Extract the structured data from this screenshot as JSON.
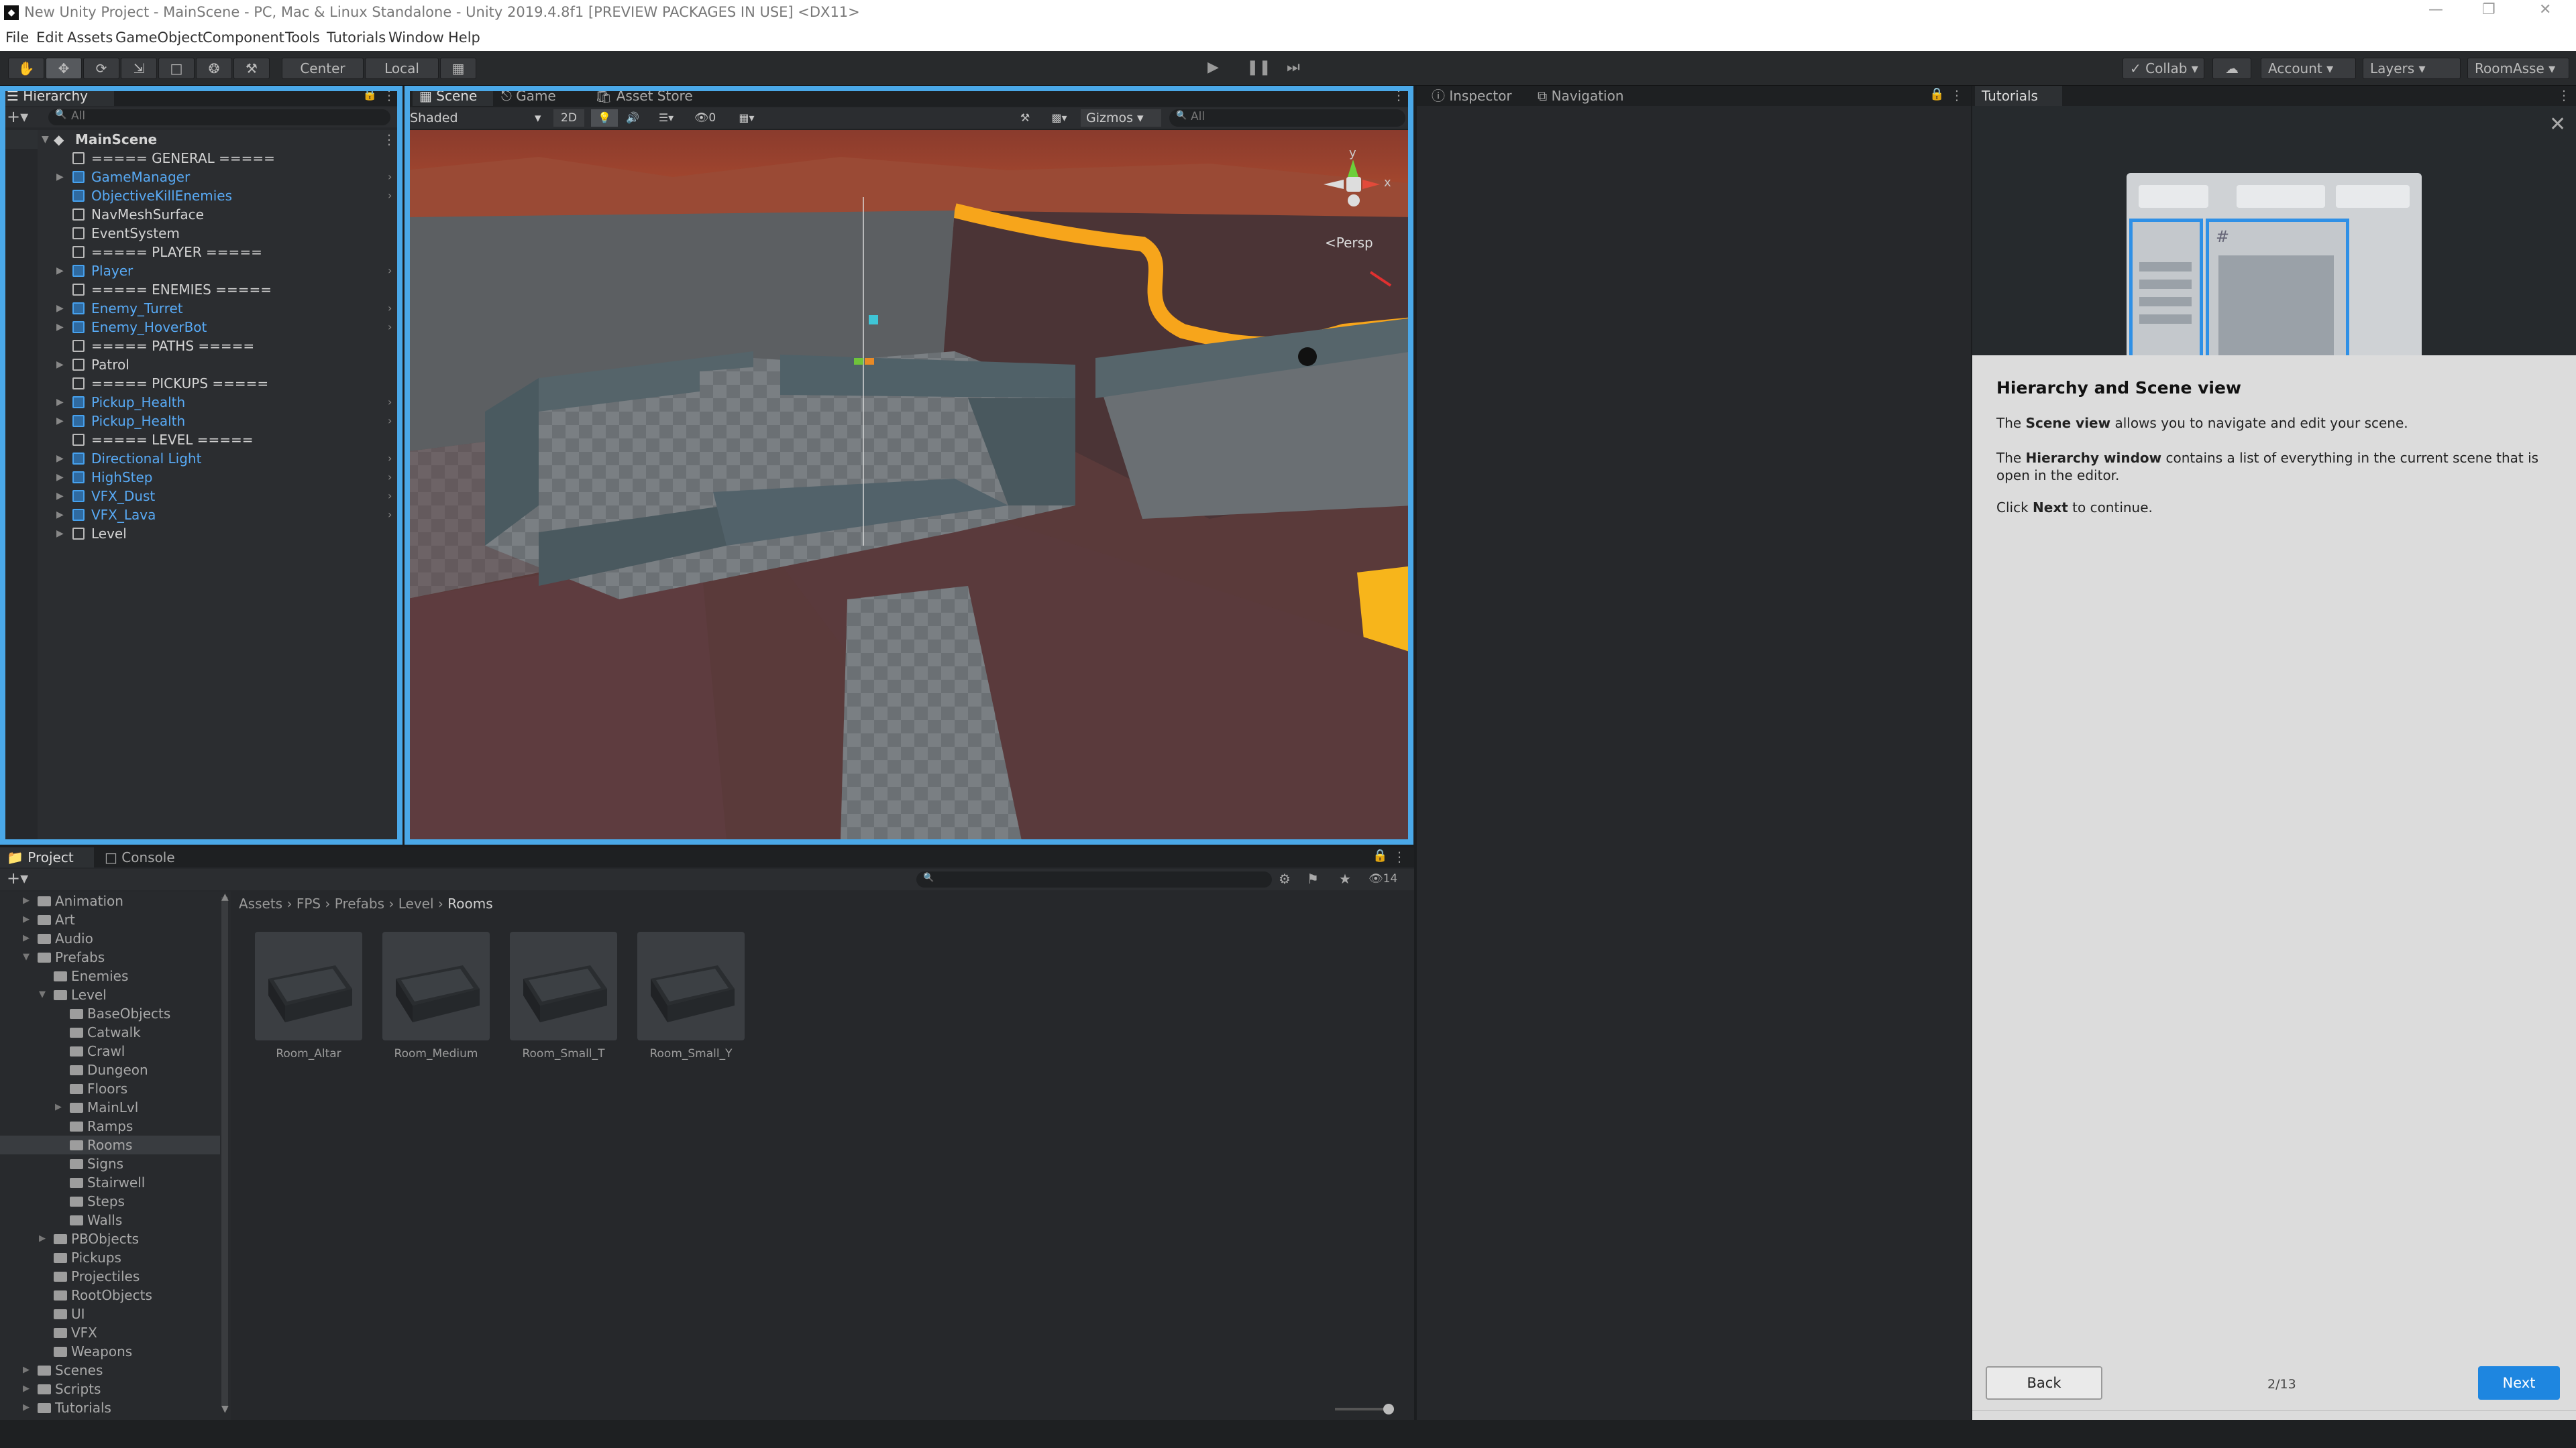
{
  "window": {
    "title": "New Unity Project - MainScene - PC, Mac & Linux Standalone - Unity 2019.4.8f1 [PREVIEW PACKAGES IN USE] <DX11>",
    "app_icon": "unity-logo-icon"
  },
  "menu": [
    "File",
    "Edit",
    "Assets",
    "GameObject",
    "Component",
    "Tools",
    "Tutorials",
    "Window",
    "Help"
  ],
  "toolbar": {
    "pivot": "Center",
    "space": "Local",
    "collab": "Collab",
    "account": "Account",
    "layers": "Layers",
    "layout": "RoomAsse"
  },
  "hierarchy": {
    "tab": "Hierarchy",
    "search_placeholder": "All",
    "scene": "MainScene",
    "items": [
      {
        "label": "===== GENERAL =====",
        "prefab": false,
        "arrow": false
      },
      {
        "label": "GameManager",
        "prefab": true,
        "arrow": true
      },
      {
        "label": "ObjectiveKillEnemies",
        "prefab": true,
        "arrow": false
      },
      {
        "label": "NavMeshSurface",
        "prefab": false,
        "arrow": false
      },
      {
        "label": "EventSystem",
        "prefab": false,
        "arrow": false
      },
      {
        "label": "===== PLAYER =====",
        "prefab": false,
        "arrow": false
      },
      {
        "label": "Player",
        "prefab": true,
        "arrow": true
      },
      {
        "label": "===== ENEMIES =====",
        "prefab": false,
        "arrow": false
      },
      {
        "label": "Enemy_Turret",
        "prefab": true,
        "arrow": true
      },
      {
        "label": "Enemy_HoverBot",
        "prefab": true,
        "arrow": true
      },
      {
        "label": "===== PATHS =====",
        "prefab": false,
        "arrow": false
      },
      {
        "label": "Patrol",
        "prefab": false,
        "arrow": true
      },
      {
        "label": "===== PICKUPS =====",
        "prefab": false,
        "arrow": false
      },
      {
        "label": "Pickup_Health",
        "prefab": true,
        "arrow": true
      },
      {
        "label": "Pickup_Health",
        "prefab": true,
        "arrow": true
      },
      {
        "label": "===== LEVEL =====",
        "prefab": false,
        "arrow": false
      },
      {
        "label": "Directional Light",
        "prefab": true,
        "arrow": true
      },
      {
        "label": "HighStep",
        "prefab": true,
        "arrow": true
      },
      {
        "label": "VFX_Dust",
        "prefab": true,
        "arrow": true
      },
      {
        "label": "VFX_Lava",
        "prefab": true,
        "arrow": true
      },
      {
        "label": "Level",
        "prefab": false,
        "arrow": true
      }
    ]
  },
  "scene": {
    "tabs": [
      "Scene",
      "Game",
      "Asset Store"
    ],
    "shading": "Shaded",
    "mode_2d": "2D",
    "hidden_count": "0",
    "gizmos": "Gizmos",
    "search_placeholder": "All",
    "persp": "Persp",
    "gizmo_y": "y",
    "gizmo_x": "x"
  },
  "inspector": {
    "tabs": [
      "Inspector",
      "Navigation"
    ]
  },
  "project": {
    "tabs": [
      "Project",
      "Console"
    ],
    "breadcrumb": [
      "Assets",
      "FPS",
      "Prefabs",
      "Level",
      "Rooms"
    ],
    "tree": [
      {
        "label": "Animation",
        "depth": 0,
        "arrow": true
      },
      {
        "label": "Art",
        "depth": 0,
        "arrow": true
      },
      {
        "label": "Audio",
        "depth": 0,
        "arrow": true
      },
      {
        "label": "Prefabs",
        "depth": 0,
        "arrow": true,
        "open": true
      },
      {
        "label": "Enemies",
        "depth": 1,
        "arrow": false
      },
      {
        "label": "Level",
        "depth": 1,
        "arrow": true,
        "open": true
      },
      {
        "label": "BaseObjects",
        "depth": 2,
        "arrow": false
      },
      {
        "label": "Catwalk",
        "depth": 2,
        "arrow": false
      },
      {
        "label": "Crawl",
        "depth": 2,
        "arrow": false
      },
      {
        "label": "Dungeon",
        "depth": 2,
        "arrow": false
      },
      {
        "label": "Floors",
        "depth": 2,
        "arrow": false
      },
      {
        "label": "MainLvl",
        "depth": 2,
        "arrow": true
      },
      {
        "label": "Ramps",
        "depth": 2,
        "arrow": false
      },
      {
        "label": "Rooms",
        "depth": 2,
        "arrow": false,
        "selected": true
      },
      {
        "label": "Signs",
        "depth": 2,
        "arrow": false
      },
      {
        "label": "Stairwell",
        "depth": 2,
        "arrow": false
      },
      {
        "label": "Steps",
        "depth": 2,
        "arrow": false
      },
      {
        "label": "Walls",
        "depth": 2,
        "arrow": false
      },
      {
        "label": "PBObjects",
        "depth": 1,
        "arrow": true
      },
      {
        "label": "Pickups",
        "depth": 1,
        "arrow": false
      },
      {
        "label": "Projectiles",
        "depth": 1,
        "arrow": false
      },
      {
        "label": "RootObjects",
        "depth": 1,
        "arrow": false
      },
      {
        "label": "UI",
        "depth": 1,
        "arrow": false
      },
      {
        "label": "VFX",
        "depth": 1,
        "arrow": false
      },
      {
        "label": "Weapons",
        "depth": 1,
        "arrow": false
      },
      {
        "label": "Scenes",
        "depth": 0,
        "arrow": true
      },
      {
        "label": "Scripts",
        "depth": 0,
        "arrow": true
      },
      {
        "label": "Tutorials",
        "depth": 0,
        "arrow": true
      }
    ],
    "assets": [
      "Room_Altar",
      "Room_Medium",
      "Room_Small_T",
      "Room_Small_Y"
    ],
    "hidden_count": "14"
  },
  "tutorial": {
    "tab": "Tutorials",
    "heading": "Hierarchy and Scene view",
    "p1_before": "The ",
    "p1_bold": "Scene view",
    "p1_after": " allows you to navigate and edit your scene.",
    "p2_before": "The ",
    "p2_bold": "Hierarchy window",
    "p2_after": " contains a list of everything in the current scene that is open in the editor.",
    "p3_before": "Click ",
    "p3_bold": "Next",
    "p3_after": " to continue.",
    "back": "Back",
    "next": "Next",
    "progress": "2/13"
  },
  "colors": {
    "accent": "#4aa8e8",
    "next_button": "#1e86e0",
    "prefab_text": "#58aaf5",
    "lava": "#f5a21a"
  }
}
